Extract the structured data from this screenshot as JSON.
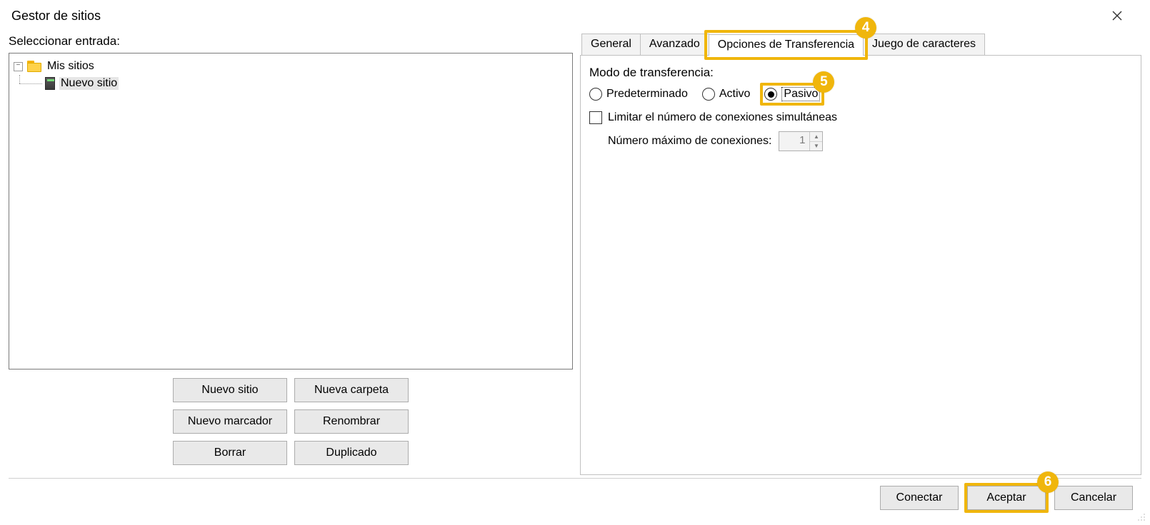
{
  "window": {
    "title": "Gestor de sitios"
  },
  "tree": {
    "select_label": "Seleccionar entrada:",
    "root_label": "Mis sitios",
    "child_label": "Nuevo sitio"
  },
  "left_buttons": {
    "new_site": "Nuevo sitio",
    "new_folder": "Nueva carpeta",
    "new_bookmark": "Nuevo marcador",
    "rename": "Renombrar",
    "delete": "Borrar",
    "duplicate": "Duplicado"
  },
  "tabs": {
    "general": "General",
    "advanced": "Avanzado",
    "transfer": "Opciones de Transferencia",
    "charset": "Juego de caracteres"
  },
  "transfer": {
    "mode_label": "Modo de transferencia:",
    "default": "Predeterminado",
    "active": "Activo",
    "passive": "Pasivo",
    "limit_label": "Limitar el número de conexiones simultáneas",
    "max_label": "Número máximo de conexiones:",
    "max_value": "1"
  },
  "footer": {
    "connect": "Conectar",
    "accept": "Aceptar",
    "cancel": "Cancelar"
  },
  "callouts": {
    "c4": "4",
    "c5": "5",
    "c6": "6"
  }
}
